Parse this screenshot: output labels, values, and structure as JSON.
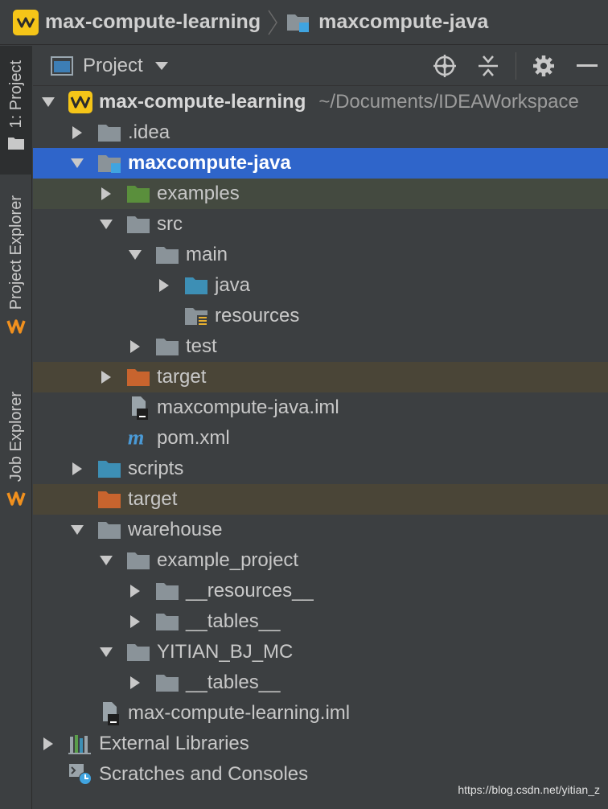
{
  "breadcrumb": {
    "project": "max-compute-learning",
    "module": "maxcompute-java"
  },
  "tool_stripe": {
    "project_tab": "1: Project",
    "project_explorer": "Project Explorer",
    "job_explorer": "Job Explorer"
  },
  "panel": {
    "title": "Project",
    "icons": [
      "locate-icon",
      "collapse-all-icon",
      "gear-icon",
      "minimize-icon"
    ]
  },
  "tree": [
    {
      "label": "max-compute-learning",
      "path": "~/Documents/IDEAWorkspace",
      "arrow": "down",
      "icon": "app-logo",
      "bold": true
    },
    {
      "label": ".idea",
      "arrow": "right",
      "icon": "folder-gray"
    },
    {
      "label": "maxcompute-java",
      "arrow": "down",
      "icon": "module-folder",
      "selected": true
    },
    {
      "label": "examples",
      "arrow": "right",
      "icon": "folder-green",
      "highlight": "green"
    },
    {
      "label": "src",
      "arrow": "down",
      "icon": "folder-gray"
    },
    {
      "label": "main",
      "arrow": "down",
      "icon": "folder-gray"
    },
    {
      "label": "java",
      "arrow": "right",
      "icon": "folder-blue"
    },
    {
      "label": "resources",
      "arrow": "none",
      "icon": "folder-resources"
    },
    {
      "label": "test",
      "arrow": "right",
      "icon": "folder-gray"
    },
    {
      "label": "target",
      "arrow": "right",
      "icon": "folder-orange",
      "highlight": "brown"
    },
    {
      "label": "maxcompute-java.iml",
      "arrow": "none",
      "icon": "iml-file"
    },
    {
      "label": "pom.xml",
      "arrow": "none",
      "icon": "maven-icon"
    },
    {
      "label": "scripts",
      "arrow": "right",
      "icon": "folder-blue"
    },
    {
      "label": "target",
      "arrow": "none",
      "icon": "folder-orange",
      "highlight": "brown"
    },
    {
      "label": "warehouse",
      "arrow": "down",
      "icon": "folder-gray"
    },
    {
      "label": "example_project",
      "arrow": "down",
      "icon": "folder-gray"
    },
    {
      "label": "__resources__",
      "arrow": "right",
      "icon": "folder-gray"
    },
    {
      "label": "__tables__",
      "arrow": "right",
      "icon": "folder-gray"
    },
    {
      "label": "YITIAN_BJ_MC",
      "arrow": "down",
      "icon": "folder-gray"
    },
    {
      "label": "__tables__",
      "arrow": "right",
      "icon": "folder-gray"
    },
    {
      "label": "max-compute-learning.iml",
      "arrow": "none",
      "icon": "iml-file"
    },
    {
      "label": "External Libraries",
      "arrow": "right",
      "icon": "libraries-icon"
    },
    {
      "label": "Scratches and Consoles",
      "arrow": "none",
      "icon": "scratches-icon"
    }
  ],
  "watermark": "https://blog.csdn.net/yitian_z",
  "colors": {
    "background": "#3c3f41",
    "selection": "#2f65ca",
    "folder_gray": "#8a9399",
    "folder_blue": "#3d8fb5",
    "folder_green": "#5a8f3c",
    "folder_orange": "#c8642e",
    "logo_yellow": "#f5c518"
  }
}
